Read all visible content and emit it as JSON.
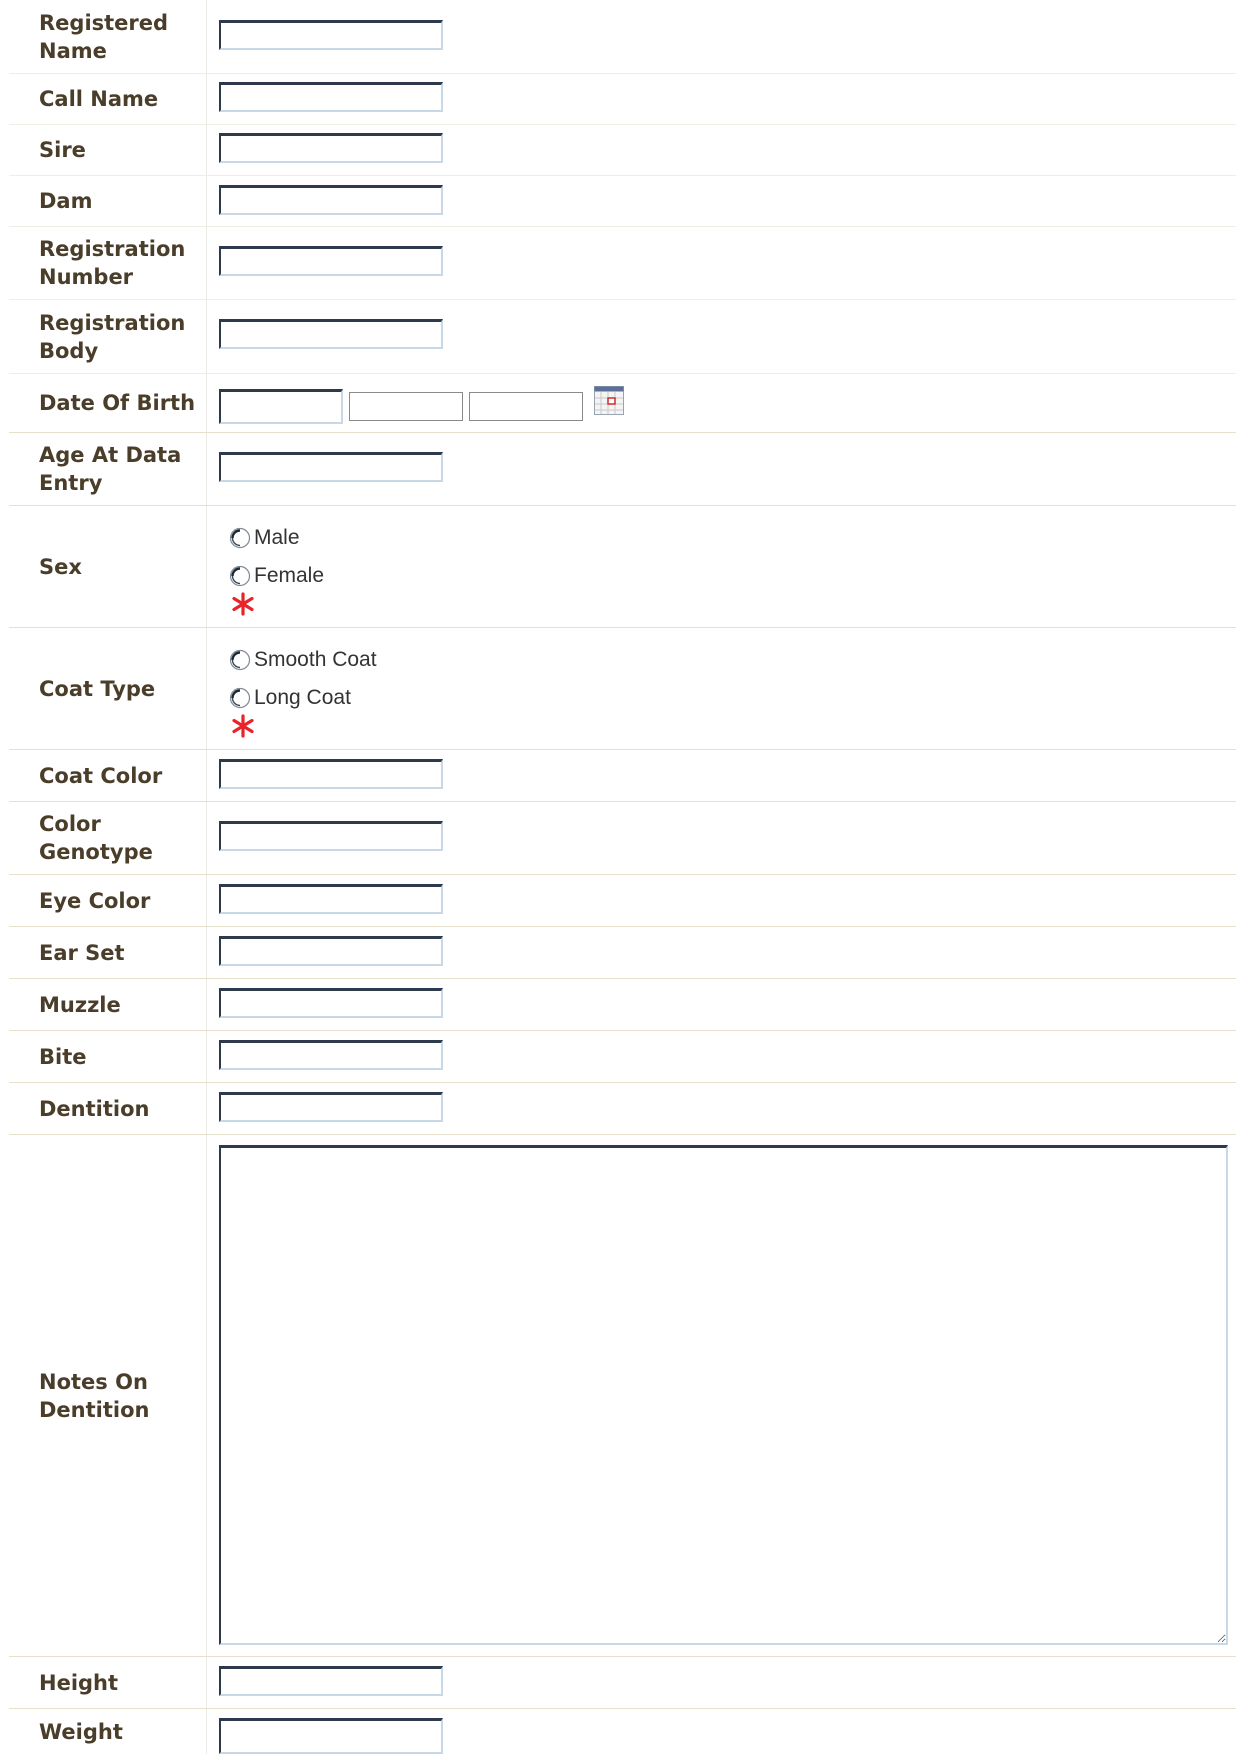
{
  "fields": {
    "registered_name": {
      "label": "Registered Name",
      "value": ""
    },
    "call_name": {
      "label": "Call Name",
      "value": ""
    },
    "sire": {
      "label": "Sire",
      "value": ""
    },
    "dam": {
      "label": "Dam",
      "value": ""
    },
    "registration_number": {
      "label": "Registration Number",
      "value": ""
    },
    "registration_body": {
      "label": "Registration Body",
      "value": ""
    },
    "date_of_birth": {
      "label": "Date Of Birth",
      "day": "",
      "month": "",
      "year": "",
      "picker_icon": "calendar-icon"
    },
    "age_at_data_entry": {
      "label": "Age At Data Entry",
      "value": ""
    },
    "sex": {
      "label": "Sex",
      "options": [
        "Male",
        "Female"
      ],
      "selected": null,
      "required_icon": "asterisk-icon"
    },
    "coat_type": {
      "label": "Coat Type",
      "options": [
        "Smooth Coat",
        "Long Coat"
      ],
      "selected": null,
      "required_icon": "asterisk-icon"
    },
    "coat_color": {
      "label": "Coat Color",
      "value": ""
    },
    "color_genotype": {
      "label": "Color Genotype",
      "value": ""
    },
    "eye_color": {
      "label": "Eye Color",
      "value": ""
    },
    "ear_set": {
      "label": "Ear Set",
      "value": ""
    },
    "muzzle": {
      "label": "Muzzle",
      "value": ""
    },
    "bite": {
      "label": "Bite",
      "value": ""
    },
    "dentition": {
      "label": "Dentition",
      "value": ""
    },
    "notes_on_dentition": {
      "label": "Notes On Dentition",
      "value": ""
    },
    "height": {
      "label": "Height",
      "value": ""
    },
    "weight": {
      "label": "Weight",
      "value": ""
    }
  },
  "colors": {
    "label_text": "#4a3d2a",
    "required": "#e8232a",
    "row_divider": "#f0ede2",
    "input_border_dark": "#2c3a4c",
    "input_border_light": "#c9d8e6"
  }
}
